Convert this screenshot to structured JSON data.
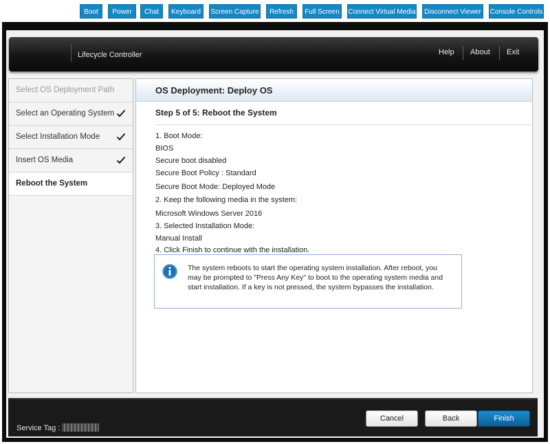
{
  "toolbar": {
    "buttons": [
      "Boot",
      "Power",
      "Chat",
      "Keyboard",
      "Screen Capture",
      "Refresh",
      "Full Screen",
      "Connect Virtual Media",
      "Disconnect Viewer",
      "Console Controls"
    ]
  },
  "header": {
    "title": "Lifecycle Controller",
    "links": [
      "Help",
      "About",
      "Exit"
    ]
  },
  "nav": {
    "items": [
      {
        "label": "Select OS Deployment Path",
        "state": "disabled",
        "done": false
      },
      {
        "label": "Select an Operating System",
        "state": "normal",
        "done": true
      },
      {
        "label": "Select Installation Mode",
        "state": "normal",
        "done": true
      },
      {
        "label": "Insert OS Media",
        "state": "normal",
        "done": true
      },
      {
        "label": "Reboot the System",
        "state": "active",
        "done": false
      }
    ]
  },
  "main": {
    "heading": "OS Deployment: Deploy OS",
    "step_title": "Step 5 of 5: Reboot the System",
    "lines": [
      "1. Boot Mode:",
      "BIOS",
      "Secure boot disabled",
      "Secure Boot Policy : Standard",
      "Secure Boot Mode: Deployed Mode",
      "2. Keep the following media in the system:",
      "Microsoft Windows Server 2016",
      "3. Selected Installation Mode:",
      "Manual Install",
      "4. Click Finish to continue with the installation."
    ],
    "info_text": "The system reboots to start the operating system installation. After reboot, you may be prompted to \"Press Any Key\" to boot to the operating system media and start installation. If a key is not pressed, the system bypasses the installation."
  },
  "footer": {
    "service_tag_label": "Service Tag :",
    "cancel_label": "Cancel",
    "back_label": "Back",
    "finish_label": "Finish"
  },
  "colors": {
    "toolbar_blue": "#1587c4",
    "finish_blue": "#0b73b5",
    "info_icon_blue": "#1a6fb5"
  }
}
